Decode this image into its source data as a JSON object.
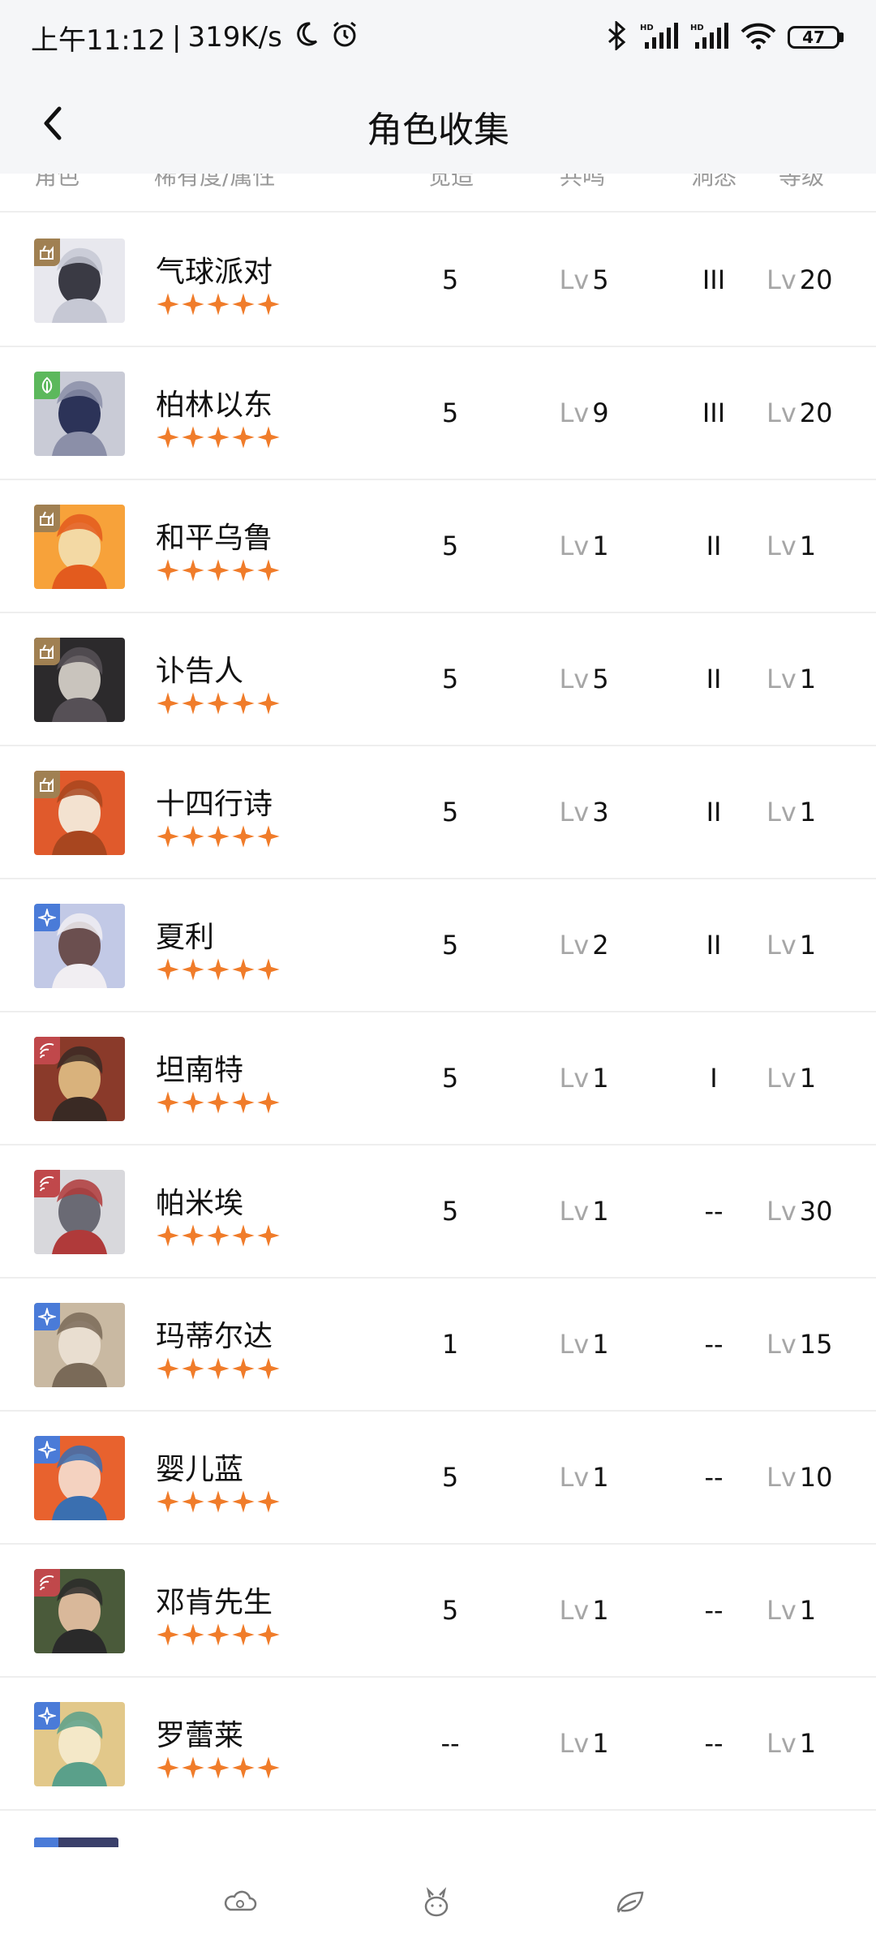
{
  "status_bar": {
    "time": "上午11:12",
    "separator": "|",
    "speed": "319K/s",
    "battery": "47"
  },
  "nav": {
    "title": "角色收集"
  },
  "columns": {
    "role": "角色",
    "rarity": "稀有度/属性",
    "juexing": "觉造",
    "gongming": "共鸣",
    "dongcha": "洞悉",
    "level": "等级"
  },
  "lv_prefix": "Lv",
  "rows": [
    {
      "name": "气球派对",
      "attr": "beast",
      "juexing": "5",
      "gongming": "5",
      "dongcha": "III",
      "level": "20"
    },
    {
      "name": "柏林以东",
      "attr": "plant",
      "juexing": "5",
      "gongming": "9",
      "dongcha": "III",
      "level": "20"
    },
    {
      "name": "和平乌鲁",
      "attr": "beast",
      "juexing": "5",
      "gongming": "1",
      "dongcha": "II",
      "level": "1"
    },
    {
      "name": "讣告人",
      "attr": "beast",
      "juexing": "5",
      "gongming": "5",
      "dongcha": "II",
      "level": "1"
    },
    {
      "name": "十四行诗",
      "attr": "beast",
      "juexing": "5",
      "gongming": "3",
      "dongcha": "II",
      "level": "1"
    },
    {
      "name": "夏利",
      "attr": "star",
      "juexing": "5",
      "gongming": "2",
      "dongcha": "II",
      "level": "1"
    },
    {
      "name": "坦南特",
      "attr": "mineral",
      "juexing": "5",
      "gongming": "1",
      "dongcha": "I",
      "level": "1"
    },
    {
      "name": "帕米埃",
      "attr": "mineral",
      "juexing": "5",
      "gongming": "1",
      "dongcha": "--",
      "level": "30"
    },
    {
      "name": "玛蒂尔达",
      "attr": "star",
      "juexing": "1",
      "gongming": "1",
      "dongcha": "--",
      "level": "15"
    },
    {
      "name": "婴儿蓝",
      "attr": "star",
      "juexing": "5",
      "gongming": "1",
      "dongcha": "--",
      "level": "10"
    },
    {
      "name": "邓肯先生",
      "attr": "mineral",
      "juexing": "5",
      "gongming": "1",
      "dongcha": "--",
      "level": "1"
    },
    {
      "name": "罗蕾莱",
      "attr": "star",
      "juexing": "--",
      "gongming": "1",
      "dongcha": "--",
      "level": "1"
    }
  ],
  "colors": {
    "star": "#f07c2a",
    "beast": "#a08052",
    "plant": "#5cb85c",
    "mineral": "#c0484b",
    "star_attr": "#4a7bd8"
  },
  "tabs": [
    "cloud-icon",
    "bunny-icon",
    "leaf-icon"
  ]
}
